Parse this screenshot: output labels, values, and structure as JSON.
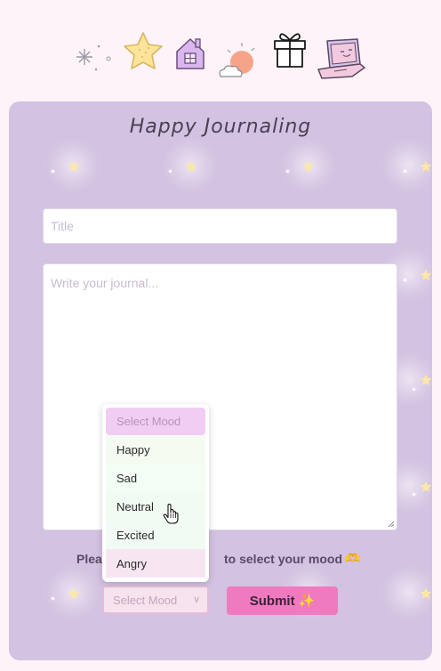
{
  "header_icons": [
    "sparkle-icon",
    "star-icon",
    "house-icon",
    "sun-cloud-icon",
    "gift-icon",
    "laptop-icon"
  ],
  "card": {
    "title": "Happy Journaling",
    "title_input": {
      "placeholder": "Title",
      "value": ""
    },
    "journal_input": {
      "placeholder": "Write your journal...",
      "value": ""
    },
    "mood_prompt": "Please select your mood to select your mood 🫶",
    "mood_prompt_visible_left": "Plea",
    "mood_prompt_visible_right": "to select your mood",
    "mood_select": {
      "selected": "Select Mood"
    },
    "submit_label": "Submit",
    "submit_emoji": "✨"
  },
  "dropdown": {
    "options": [
      "Select Mood",
      "Happy",
      "Sad",
      "Neutral",
      "Excited",
      "Angry"
    ],
    "hovered": "Neutral"
  },
  "colors": {
    "page_bg": "#fdf3f8",
    "card_bg": "#d3c2e1",
    "submit_bg": "#f07ac0",
    "select_bg": "#f7e3ee",
    "placeholder_option_bg": "#f2cdf3"
  }
}
